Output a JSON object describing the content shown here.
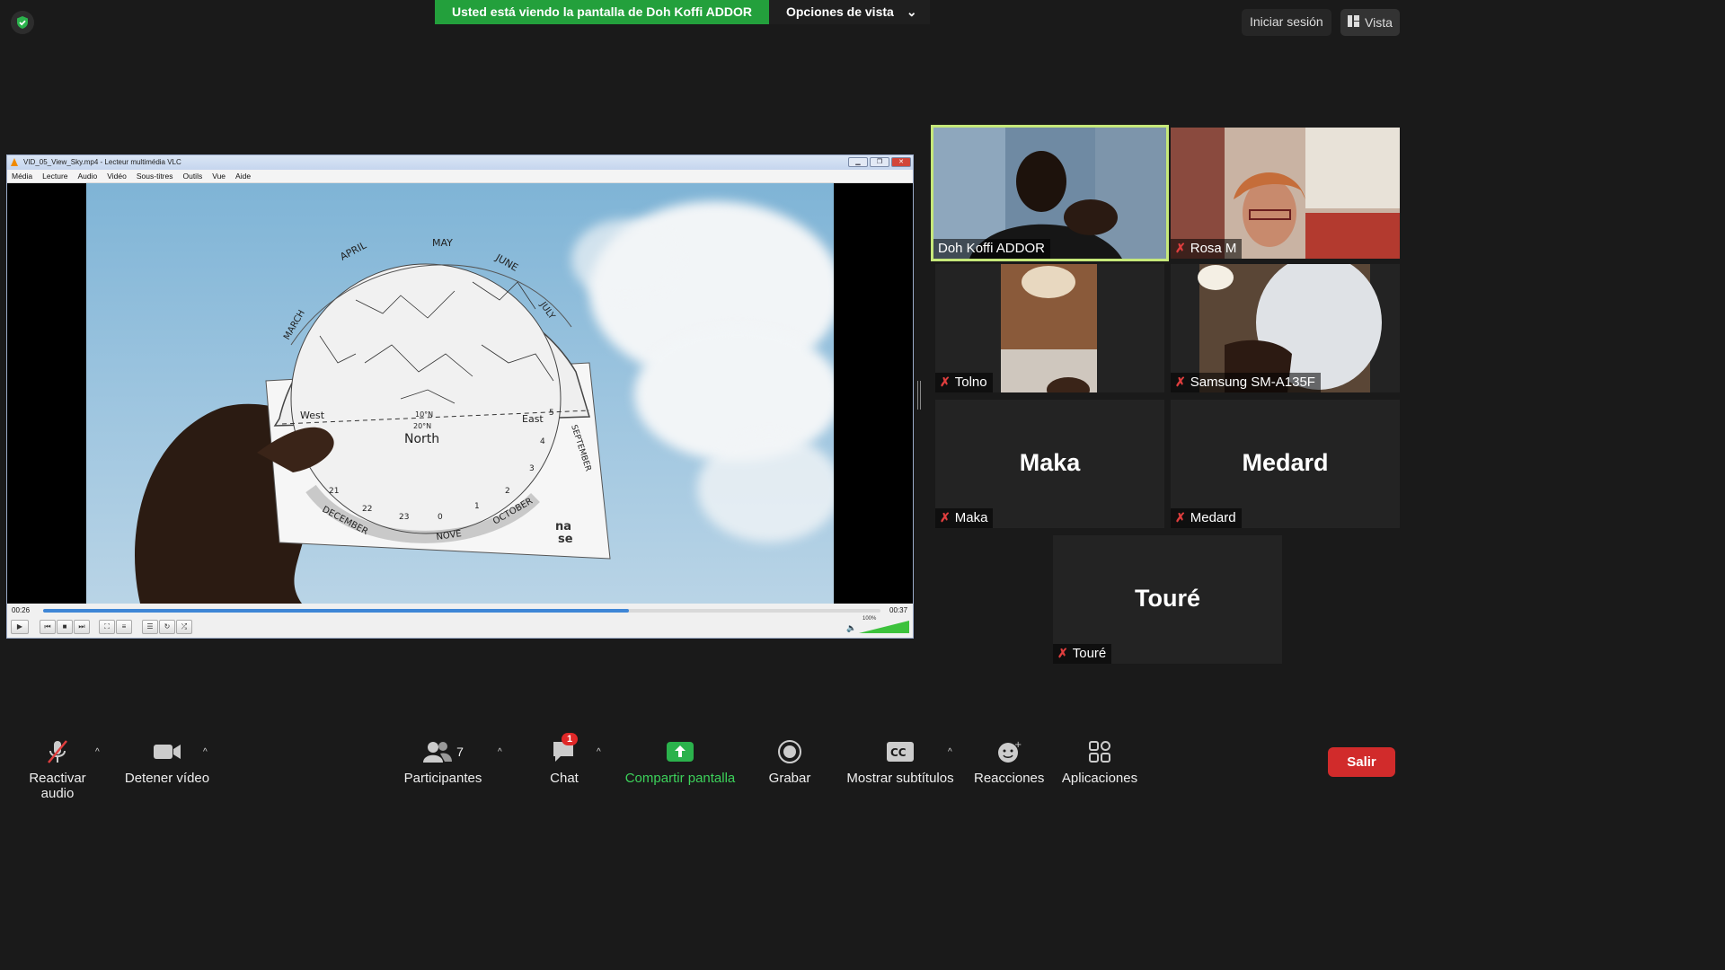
{
  "top": {
    "share_text": "Usted está viendo la pantalla de Doh Koffi ADDOR",
    "view_options": "Opciones de vista",
    "signin": "Iniciar sesión",
    "view": "Vista"
  },
  "vlc": {
    "title": "VID_05_View_Sky.mp4 - Lecteur multimédia VLC",
    "menu": [
      "Média",
      "Lecture",
      "Audio",
      "Vidéo",
      "Sous-titres",
      "Outils",
      "Vue",
      "Aide"
    ],
    "elapsed": "00:26",
    "total": "00:37",
    "progress": 0.7,
    "volume_label": "100%",
    "volume": 1.0,
    "planisphere": {
      "months": [
        "APRIL",
        "MAY",
        "JUNE",
        "JULY",
        "MARCH",
        "SEPTEMBER",
        "DECEMBER",
        "NOVE",
        "OCTOBER"
      ],
      "west": "West",
      "east": "East",
      "north": "North",
      "lat1": "10°N",
      "lat2": "20°N",
      "hours": [
        "21",
        "22",
        "23",
        "0",
        "1",
        "2",
        "3",
        "4",
        "5"
      ],
      "logo_top": "na",
      "logo_bottom": "se"
    }
  },
  "participants": [
    {
      "name": "Doh Koffi ADDOR",
      "muted": false,
      "active": true
    },
    {
      "name": "Rosa M",
      "muted": true
    },
    {
      "name": "Tolno",
      "muted": true
    },
    {
      "name": "Samsung SM-A135F",
      "muted": true
    },
    {
      "name": "Maka",
      "muted": true,
      "big": "Maka"
    },
    {
      "name": "Medard",
      "muted": true,
      "big": "Medard"
    },
    {
      "name": "Touré",
      "muted": true,
      "big": "Touré"
    }
  ],
  "toolbar": {
    "audio": "Reactivar audio",
    "video": "Detener vídeo",
    "participants": "Participantes",
    "participants_count": "7",
    "chat": "Chat",
    "chat_badge": "1",
    "share": "Compartir pantalla",
    "record": "Grabar",
    "captions": "Mostrar subtítulos",
    "reactions": "Reacciones",
    "apps": "Aplicaciones",
    "leave": "Salir"
  },
  "colors": {
    "share_green": "#23a03c",
    "active_border": "#c6e87a",
    "leave_red": "#d12b2b",
    "mute_red": "#e03e3e"
  }
}
